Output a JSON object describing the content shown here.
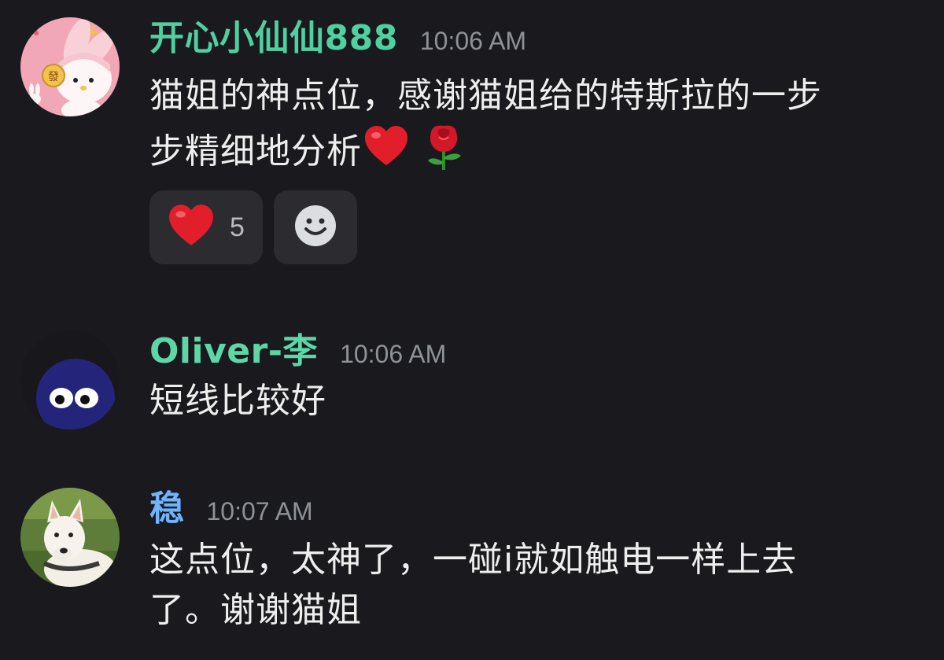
{
  "messages": [
    {
      "username": "开心小仙仙888",
      "timestamp": "10:06 AM",
      "name_color": "#4fd0a0",
      "avatar_icon": "melody-avatar-icon",
      "text_line1": "猫姐的神点位，感谢猫姐给的特斯拉的一步",
      "text_line2": "步精细地分析",
      "inline_emojis": [
        "heart-emoji",
        "rose-emoji"
      ],
      "reactions": [
        {
          "emoji": "heart-emoji",
          "count": "5"
        }
      ],
      "add_reaction_icon": "smiley-add-reaction-icon"
    },
    {
      "username": "Oliver-李",
      "timestamp": "10:06 AM",
      "name_color": "#5dd6a8",
      "avatar_icon": "googly-eyes-avatar-icon",
      "text": "短线比较好"
    },
    {
      "username": "稳",
      "timestamp": "10:07 AM",
      "name_color": "#6fb4ff",
      "avatar_icon": "white-dog-avatar-icon",
      "text_line1": "这点位，太神了，一碰i就如触电一样上去",
      "text_line2": "了。谢谢猫姐"
    }
  ],
  "colors": {
    "background": "#1a1a1e",
    "timestamp": "#8e9297",
    "reaction_bg": "#2b2b30"
  }
}
